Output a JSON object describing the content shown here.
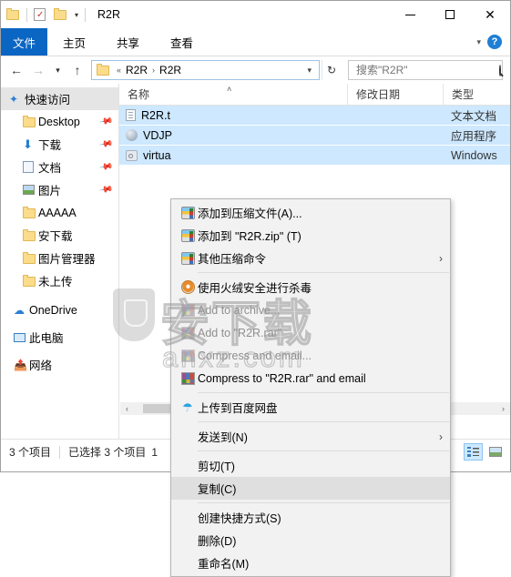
{
  "titlebar": {
    "title": "R2R",
    "quick_access": [
      "folder-icon",
      "properties-icon",
      "new-folder-icon",
      "customize-caret"
    ],
    "minimize": "─",
    "maximize": "□",
    "close": "✕"
  },
  "ribbon": {
    "file_tab": "文件",
    "tabs": [
      "主页",
      "共享",
      "查看"
    ],
    "collapse_caret": "⌄",
    "help": "?"
  },
  "address": {
    "back": "←",
    "forward": "→",
    "recent_caret": "⌄",
    "up": "↑",
    "crumb_prefix": "«",
    "crumbs": [
      "R2R",
      "R2R"
    ],
    "crumb_sep": "›",
    "dropdown_caret": "⌄",
    "refresh": "↻",
    "search_placeholder": "搜索\"R2R\"",
    "search_value": ""
  },
  "sidebar": {
    "items": [
      {
        "label": "快速访问",
        "icon": "star-pin-icon",
        "level": 1,
        "selected": true,
        "pin": ""
      },
      {
        "label": "Desktop",
        "icon": "folder-icon",
        "level": 2,
        "selected": false,
        "pin": "📌"
      },
      {
        "label": "下载",
        "icon": "download-arrow-icon",
        "level": 2,
        "selected": false,
        "pin": "📌"
      },
      {
        "label": "文档",
        "icon": "documents-icon",
        "level": 2,
        "selected": false,
        "pin": "📌"
      },
      {
        "label": "图片",
        "icon": "pictures-icon",
        "level": 2,
        "selected": false,
        "pin": "📌"
      },
      {
        "label": "AAAAA",
        "icon": "folder-icon",
        "level": 2,
        "selected": false,
        "pin": ""
      },
      {
        "label": "安下载",
        "icon": "folder-icon",
        "level": 2,
        "selected": false,
        "pin": ""
      },
      {
        "label": "图片管理器",
        "icon": "folder-icon",
        "level": 2,
        "selected": false,
        "pin": ""
      },
      {
        "label": "未上传",
        "icon": "folder-icon",
        "level": 2,
        "selected": false,
        "pin": ""
      },
      {
        "label": "OneDrive",
        "icon": "cloud-icon",
        "level": 1,
        "selected": false,
        "pin": ""
      },
      {
        "label": "此电脑",
        "icon": "this-pc-icon",
        "level": 1,
        "selected": false,
        "pin": ""
      },
      {
        "label": "网络",
        "icon": "network-icon",
        "level": 1,
        "selected": false,
        "pin": ""
      }
    ]
  },
  "filelist": {
    "columns": [
      "名称",
      "修改日期",
      "类型"
    ],
    "sort_indicator": "˄",
    "rows": [
      {
        "name": "R2R.t",
        "icon": "text-file-icon",
        "date": "",
        "type": "文本文档"
      },
      {
        "name": "VDJP",
        "icon": "application-icon",
        "date": "",
        "type": "应用程序"
      },
      {
        "name": "virtua",
        "icon": "system-file-icon",
        "date": "",
        "type": "Windows"
      }
    ]
  },
  "context_menu": {
    "items": [
      {
        "label": "添加到压缩文件(A)...",
        "icon": "winrar-icon",
        "disabled": false,
        "highlighted": false,
        "submenu": false,
        "separator_after": false
      },
      {
        "label": "添加到 \"R2R.zip\" (T)",
        "icon": "winrar-icon",
        "disabled": false,
        "highlighted": false,
        "submenu": false,
        "separator_after": false
      },
      {
        "label": "其他压缩命令",
        "icon": "winrar-icon",
        "disabled": false,
        "highlighted": false,
        "submenu": true,
        "separator_after": true
      },
      {
        "label": "使用火绒安全进行杀毒",
        "icon": "huorong-shield-icon",
        "disabled": false,
        "highlighted": false,
        "submenu": false,
        "separator_after": false
      },
      {
        "label": "Add to archive...",
        "icon": "winrar-alt-icon",
        "disabled": true,
        "highlighted": false,
        "submenu": false,
        "separator_after": false
      },
      {
        "label": "Add to \"R2R.rar\"",
        "icon": "winrar-alt-icon",
        "disabled": true,
        "highlighted": false,
        "submenu": false,
        "separator_after": false
      },
      {
        "label": "Compress and email...",
        "icon": "winrar-alt-icon",
        "disabled": true,
        "highlighted": false,
        "submenu": false,
        "separator_after": false
      },
      {
        "label": "Compress to \"R2R.rar\" and email",
        "icon": "winrar-alt-icon",
        "disabled": false,
        "highlighted": false,
        "submenu": false,
        "separator_after": true
      },
      {
        "label": "上传到百度网盘",
        "icon": "baidu-netdisk-icon",
        "disabled": false,
        "highlighted": false,
        "submenu": false,
        "separator_after": true
      },
      {
        "label": "发送到(N)",
        "icon": "",
        "disabled": false,
        "highlighted": false,
        "submenu": true,
        "separator_after": true
      },
      {
        "label": "剪切(T)",
        "icon": "",
        "disabled": false,
        "highlighted": false,
        "submenu": false,
        "separator_after": false
      },
      {
        "label": "复制(C)",
        "icon": "",
        "disabled": false,
        "highlighted": true,
        "submenu": false,
        "separator_after": true
      },
      {
        "label": "创建快捷方式(S)",
        "icon": "",
        "disabled": false,
        "highlighted": false,
        "submenu": false,
        "separator_after": false
      },
      {
        "label": "删除(D)",
        "icon": "",
        "disabled": false,
        "highlighted": false,
        "submenu": false,
        "separator_after": false
      },
      {
        "label": "重命名(M)",
        "icon": "",
        "disabled": false,
        "highlighted": false,
        "submenu": false,
        "separator_after": false
      }
    ]
  },
  "watermark": {
    "main": "安下载",
    "sub": "anxz.com"
  },
  "scrollbar": {
    "left_arrow": "‹",
    "right_arrow": "›"
  },
  "statusbar": {
    "item_count": "3 个项目",
    "selection": "已选择 3 个项目",
    "size": "1",
    "view_details": "details-view-icon",
    "view_thumbnails": "thumbnail-view-icon"
  },
  "colors": {
    "accent": "#0b65c2",
    "selection": "#cde8ff",
    "menu_bg": "#f2f2f2"
  }
}
